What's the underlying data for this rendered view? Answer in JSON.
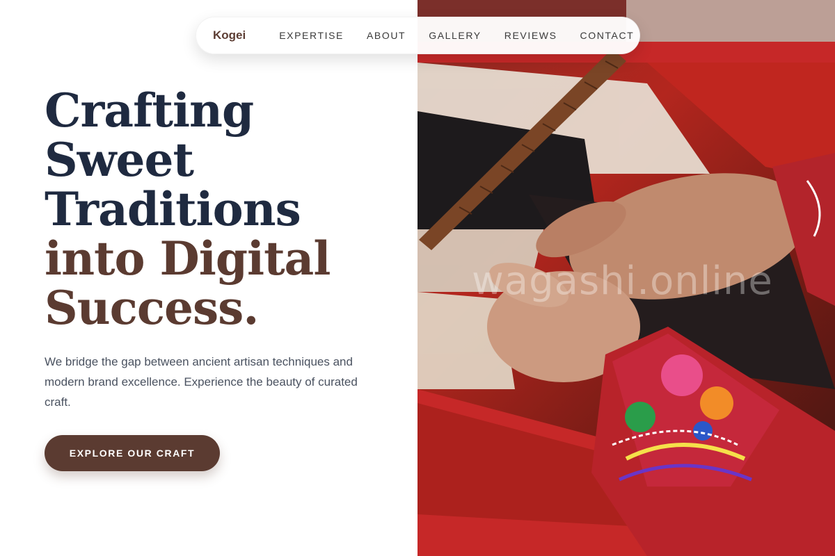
{
  "nav": {
    "logo": "Kogei",
    "links": [
      "EXPERTISE",
      "ABOUT",
      "GALLERY",
      "REVIEWS",
      "CONTACT"
    ]
  },
  "hero": {
    "headline_lines": [
      "Crafting",
      "Sweet",
      "Traditions",
      "into Digital",
      "Success."
    ],
    "subtext": "We bridge the gap between ancient artisan techniques and modern brand excellence. Experience the beauty of curated craft.",
    "cta_label": "EXPLORE OUR CRAFT",
    "image_watermark": "wagashi.online"
  },
  "colors": {
    "headline_dark": "#1f2a40",
    "headline_accent": "#5b3b31",
    "cta_background": "#5b3b31",
    "body_text": "#4a5260"
  }
}
